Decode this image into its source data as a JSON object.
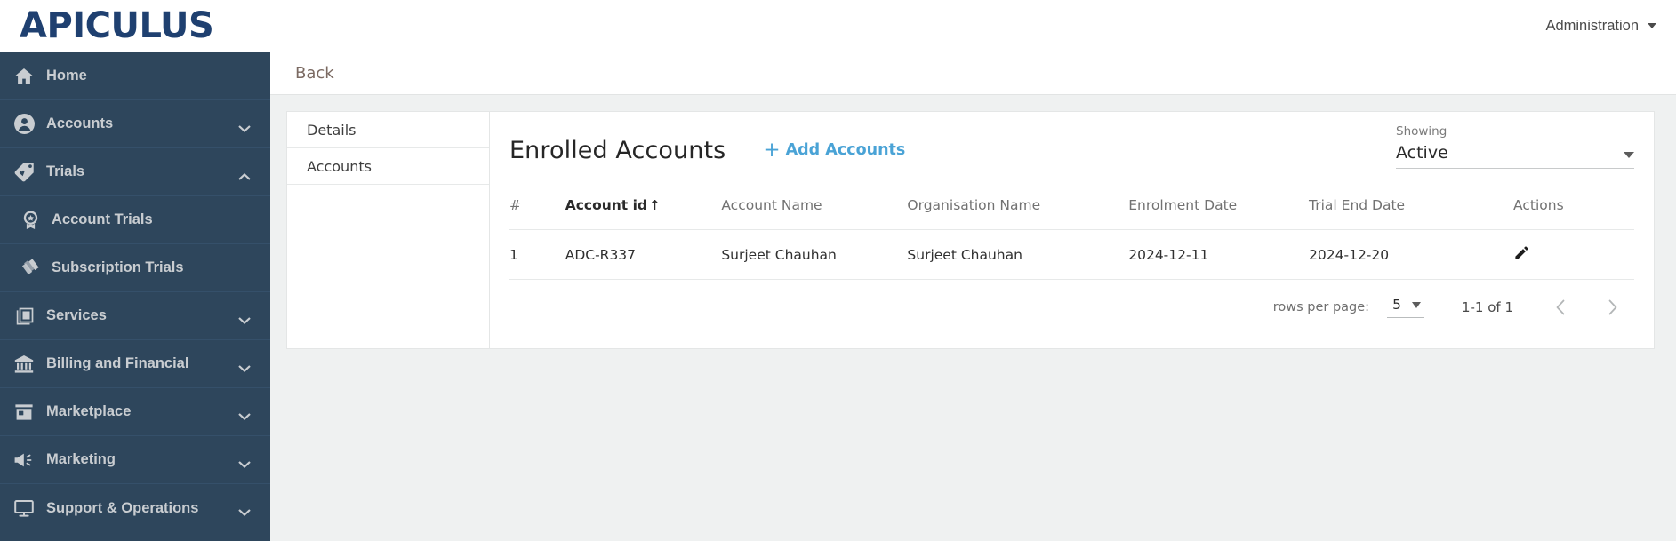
{
  "topbar": {
    "logo_text": "APICULUS",
    "logo_color": "#1f4070",
    "admin_label": "Administration",
    "admin_caret_icon": "caret-down-icon"
  },
  "sidebar": {
    "bg_color": "#2e465c",
    "items": [
      {
        "label": "Home",
        "icon": "home-icon",
        "chevron": "",
        "sub": false
      },
      {
        "label": "Accounts",
        "icon": "user-circle-icon",
        "chevron": "down",
        "sub": false
      },
      {
        "label": "Trials",
        "icon": "tag-heart-icon",
        "chevron": "up",
        "sub": false
      },
      {
        "label": "Account Trials",
        "icon": "badge-star-icon",
        "chevron": "",
        "sub": true
      },
      {
        "label": "Subscription Trials",
        "icon": "cards-stack-icon",
        "chevron": "",
        "sub": true
      },
      {
        "label": "Services",
        "icon": "layers-image-icon",
        "chevron": "down",
        "sub": false
      },
      {
        "label": "Billing and Financial",
        "icon": "bank-icon",
        "chevron": "down",
        "sub": false
      },
      {
        "label": "Marketplace",
        "icon": "storefront-icon",
        "chevron": "down",
        "sub": false
      },
      {
        "label": "Marketing",
        "icon": "megaphone-icon",
        "chevron": "down",
        "sub": false
      },
      {
        "label": "Support & Operations",
        "icon": "monitor-icon",
        "chevron": "down",
        "sub": false
      }
    ]
  },
  "main": {
    "back_label": "Back",
    "tabs": [
      {
        "label": "Details"
      },
      {
        "label": "Accounts"
      }
    ],
    "page_title": "Enrolled Accounts",
    "add_accounts_label": "Add Accounts",
    "add_accounts_icon": "plus-icon",
    "add_accounts_color": "#4aa3d6",
    "showing": {
      "label": "Showing",
      "value": "Active",
      "caret_icon": "caret-down-icon"
    },
    "table": {
      "columns": [
        {
          "key": "num",
          "label": "#",
          "sorted": false,
          "sort_arrow": ""
        },
        {
          "key": "id",
          "label": "Account id",
          "sorted": true,
          "sort_arrow": "↑"
        },
        {
          "key": "name",
          "label": "Account Name",
          "sorted": false,
          "sort_arrow": ""
        },
        {
          "key": "org",
          "label": "Organisation Name",
          "sorted": false,
          "sort_arrow": ""
        },
        {
          "key": "enrol",
          "label": "Enrolment Date",
          "sorted": false,
          "sort_arrow": ""
        },
        {
          "key": "trial",
          "label": "Trial End Date",
          "sorted": false,
          "sort_arrow": ""
        },
        {
          "key": "act",
          "label": "Actions",
          "sorted": false,
          "sort_arrow": ""
        }
      ],
      "rows": [
        {
          "num": "1",
          "id": "ADC-R337",
          "name": "Surjeet Chauhan",
          "org": "Surjeet Chauhan",
          "enrol": "2024-12-11",
          "trial": "2024-12-20",
          "action_icon": "pencil-edit-icon"
        }
      ]
    },
    "pagination": {
      "rows_per_page_label": "rows per page:",
      "rows_per_page_value": "5",
      "range_label": "1-1 of 1",
      "prev_icon": "chevron-left-icon",
      "next_icon": "chevron-right-icon"
    }
  }
}
